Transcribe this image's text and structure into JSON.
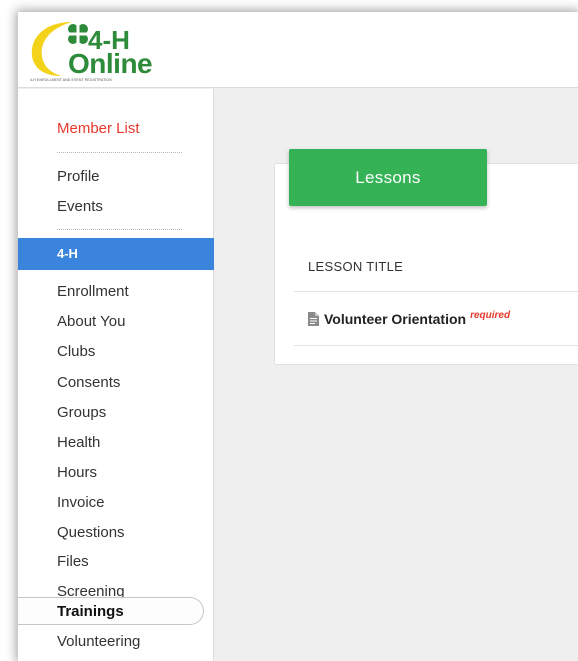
{
  "logo": {
    "brand_line1": "4-H",
    "brand_line2": "Online",
    "tagline": "4-H ENROLLMENT AND EVENT REGISTRATION",
    "colors": {
      "green": "#2e8b3a",
      "yellow": "#f3d21a"
    }
  },
  "sidebar": {
    "member_list": "Member List",
    "top_links": [
      "Profile",
      "Events"
    ],
    "section_label": "4-H",
    "items": [
      "Enrollment",
      "About You",
      "Clubs",
      "Consents",
      "Groups",
      "Health",
      "Hours",
      "Invoice",
      "Questions",
      "Files",
      "Screening",
      "Trainings",
      "Volunteering"
    ],
    "active_item": "Trainings",
    "section_color": "#3b84dd"
  },
  "main": {
    "tab_label": "Lessons",
    "tab_color": "#34b255",
    "column_header": "LESSON TITLE",
    "lessons": [
      {
        "title": "Volunteer Orientation",
        "badge": "required",
        "icon": "document-icon"
      }
    ]
  }
}
